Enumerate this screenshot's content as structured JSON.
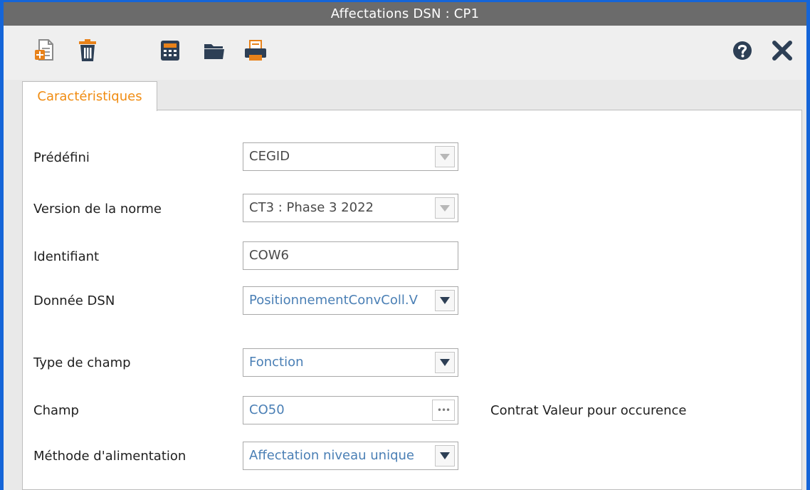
{
  "window": {
    "title": "Affectations DSN :  CP1"
  },
  "toolbar": {
    "icons": [
      "new-document-icon",
      "trash-icon",
      "calculator-icon",
      "folder-icon",
      "printer-icon",
      "help-icon",
      "close-icon"
    ]
  },
  "tabs": [
    {
      "label": "Caractéristiques",
      "active": true
    }
  ],
  "form": {
    "predefini": {
      "label": "Prédéfini",
      "value": "CEGID"
    },
    "version": {
      "label": "Version de la norme",
      "value": "CT3 : Phase 3 2022"
    },
    "identifiant": {
      "label": "Identifiant",
      "value": "COW6"
    },
    "donnee": {
      "label": "Donnée DSN",
      "value": "PositionnementConvColl.V"
    },
    "type": {
      "label": "Type de champ",
      "value": "Fonction"
    },
    "champ": {
      "label": "Champ",
      "value": "CO50",
      "description": "Contrat Valeur pour occurence",
      "ellipsis": "•••"
    },
    "methode": {
      "label": "Méthode d'alimentation",
      "value": "Affectation niveau unique"
    }
  },
  "colors": {
    "window_border": "#1565d8",
    "titlebar": "#6b6b6b",
    "tab_text": "#f08c12",
    "icon_orange": "#e8821a",
    "icon_navy": "#2d3f55",
    "field_blue_text": "#4a7fb5"
  }
}
